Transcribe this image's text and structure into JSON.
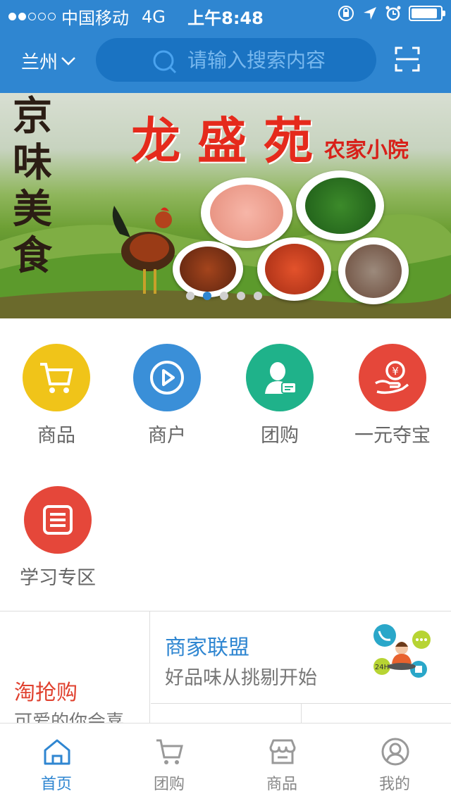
{
  "status_bar": {
    "carrier": "中国移动",
    "network": "4G",
    "time": "上午8:48",
    "signal_strength": 2,
    "signal_total": 5,
    "battery_level": 0.9
  },
  "header": {
    "city": "兰州",
    "search_placeholder": "请输入搜索内容",
    "colors": {
      "bar": "#2f86d1",
      "search_bg": "#1a73c2"
    },
    "icons": {
      "dropdown": "chevron-down-icon",
      "search": "search-icon",
      "scan": "scan-icon"
    }
  },
  "banner": {
    "title": "龙盛苑",
    "subtitle": "农家小院",
    "side_text": "京味美食",
    "pages": 5,
    "active_page": 2
  },
  "categories": [
    {
      "label": "商品",
      "color": "#f0c419",
      "icon": "cart-icon"
    },
    {
      "label": "商户",
      "color": "#3a8fd8",
      "icon": "play-icon"
    },
    {
      "label": "团购",
      "color": "#1fb28a",
      "icon": "user-card-icon"
    },
    {
      "label": "一元夺宝",
      "color": "#e5473a",
      "icon": "yuan-hand-icon"
    },
    {
      "label": "学习专区",
      "color": "#e5473a",
      "icon": "notebook-icon"
    }
  ],
  "promo": {
    "left_title": "淘抢购",
    "left_subtitle": "可爱的你会喜",
    "right_title": "商家联盟",
    "right_subtitle": "好品味从挑剔开始"
  },
  "tabbar": [
    {
      "label": "首页",
      "icon": "home-icon",
      "active": true
    },
    {
      "label": "团购",
      "icon": "cart-icon",
      "active": false
    },
    {
      "label": "商品",
      "icon": "store-icon",
      "active": false
    },
    {
      "label": "我的",
      "icon": "profile-icon",
      "active": false
    }
  ],
  "colors": {
    "accent": "#2f86d1",
    "promo_red": "#e0412f",
    "label_gray": "#666666"
  }
}
